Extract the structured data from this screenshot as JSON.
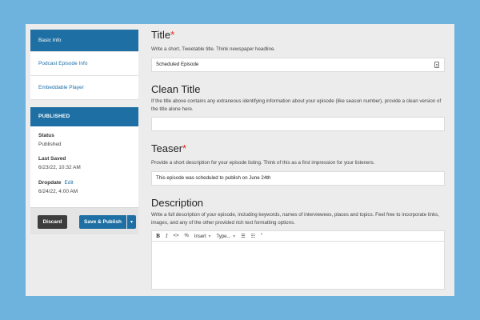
{
  "sidebar": {
    "nav": [
      {
        "label": "Basic Info",
        "active": true
      },
      {
        "label": "Podcast Episode Info",
        "active": false
      },
      {
        "label": "Embeddable Player",
        "active": false
      }
    ],
    "publish_panel": {
      "header": "PUBLISHED",
      "status_label": "Status",
      "status_value": "Published",
      "last_saved_label": "Last Saved",
      "last_saved_value": "6/23/22, 10:32 AM",
      "dropdate_label": "Dropdate",
      "dropdate_edit": "Edit",
      "dropdate_value": "6/24/22, 4:00 AM"
    },
    "actions": {
      "discard": "Discard",
      "save_publish": "Save & Publish",
      "caret": "▾"
    }
  },
  "form": {
    "title": {
      "label": "Title",
      "required_mark": "*",
      "help": "Write a short, Tweetable title. Think newspaper headline.",
      "value": "Scheduled Episode"
    },
    "clean_title": {
      "label": "Clean Title",
      "help": "If the title above contains any extraneous identifying information about your episode (like season number), provide a clean version of the title alone here.",
      "value": ""
    },
    "teaser": {
      "label": "Teaser",
      "required_mark": "*",
      "help": "Provide a short description for your episode listing. Think of this as a first impression for your listeners.",
      "value": "This episode was scheduled to publish on June 24th"
    },
    "description": {
      "label": "Description",
      "help": "Write a full description of your episode, including keywords, names of interviewees, places and topics. Feel free to incorporate links, images, and any of the other provided rich text formatting options.",
      "toolbar": {
        "bold": "B",
        "italic": "I",
        "code": "<>",
        "link": "%",
        "insert": "Insert",
        "type": "Type...",
        "dropdown_caret": "▾",
        "bullet_list": "☰",
        "numbered_list": "☷",
        "quote": "“"
      }
    }
  },
  "colors": {
    "background": "#6eb3de",
    "primary": "#1e6fa3",
    "required": "#e0261b",
    "discard": "#3d3d3d"
  }
}
